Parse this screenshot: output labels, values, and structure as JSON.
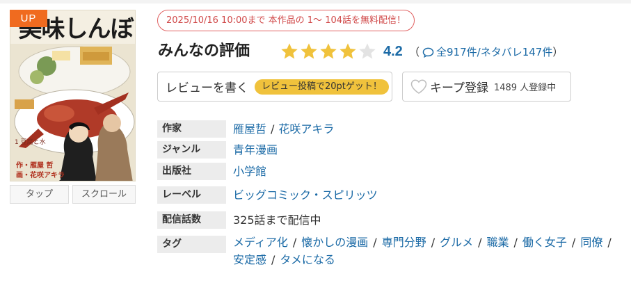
{
  "cover": {
    "title_art": "美味しんぼ",
    "volume_caption": "1 豆腐と水",
    "credit_lines": [
      "作・雁屋 哲",
      "画・花咲アキラ"
    ],
    "badge": "UP"
  },
  "view_buttons": {
    "tap": "タップ",
    "scroll": "スクロール"
  },
  "free_notice": "2025/10/16 10:00まで 本作品の 1～ 104話を無料配信！",
  "rating": {
    "title": "みんなの評価",
    "score": "4.2",
    "stars_filled": 4,
    "stars_total": 5,
    "open_paren": "（",
    "counts_text": "全917件/ネタバレ147件",
    "close_paren": "）"
  },
  "review_button": {
    "label": "レビューを書く",
    "promo": "レビュー投稿で20ptゲット！"
  },
  "keep_button": {
    "label": "キープ登録",
    "count": "1489 人登録中"
  },
  "details": {
    "author": {
      "label": "作家",
      "names": [
        "雁屋哲",
        "花咲アキラ"
      ],
      "separator": "/"
    },
    "genre": {
      "label": "ジャンル",
      "value": "青年漫画"
    },
    "publisher": {
      "label": "出版社",
      "value": "小学館"
    },
    "label": {
      "label": "レーベル",
      "value": "ビッグコミック・スピリッツ"
    },
    "episodes": {
      "label": "配信話数",
      "value": "325話まで配信中"
    },
    "tags": {
      "label": "タグ",
      "items": [
        "メディア化",
        "懐かしの漫画",
        "専門分野",
        "グルメ",
        "職業",
        "働く女子",
        "同僚",
        "安定感",
        "タメになる"
      ],
      "separator": "/"
    }
  },
  "colors": {
    "accent_link": "#1b6aa6",
    "badge_orange": "#f06b1f",
    "star_gold": "#f0c23c",
    "notice_red": "#d04848"
  }
}
